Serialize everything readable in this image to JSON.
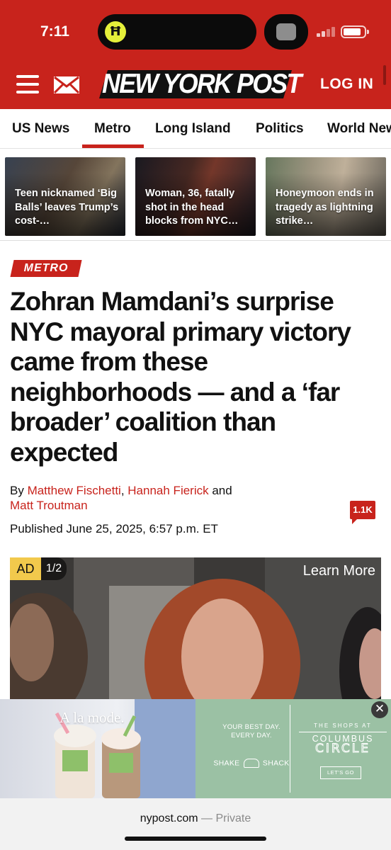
{
  "status_bar": {
    "time": "7:11",
    "island_app_glyph": "Ħ"
  },
  "header": {
    "logo_text": "NEW YORK POST",
    "login_label": "LOG IN",
    "background": "#c8231c"
  },
  "nav": {
    "items": [
      {
        "label": "US News",
        "active": false
      },
      {
        "label": "Metro",
        "active": true
      },
      {
        "label": "Long Island",
        "active": false
      },
      {
        "label": "Politics",
        "active": false
      },
      {
        "label": "World News",
        "active": false
      }
    ]
  },
  "trending": [
    {
      "title": "Teen nicknamed ‘Big Balls’ leaves Trump’s cost-…"
    },
    {
      "title": "Woman, 36, fatally shot in the head blocks from NYC…"
    },
    {
      "title": "Honeymoon ends in tragedy as lightning strike…"
    }
  ],
  "article": {
    "kicker": "METRO",
    "headline": "Zohran Mamdani’s surprise NYC mayoral primary victory came from these neighborhoods — and a ‘far broader’ coalition than expected",
    "byline_prefix": "By ",
    "authors": [
      "Matthew Fischetti",
      "Hannah Fierick",
      "Matt Troutman"
    ],
    "byline_sep": ", ",
    "byline_and": " and ",
    "comment_count": "1.1K",
    "published": "Published June 25, 2025, 6:57 p.m. ET"
  },
  "video_ad": {
    "badge": "AD",
    "counter": "1/2",
    "learn_more": "Learn More"
  },
  "banner_ad": {
    "headline": "A la mode.",
    "tagline_line1": "YOUR BEST DAY.",
    "tagline_line2": "EVERY DAY.",
    "brand_left": "SHAKE",
    "brand_right": "SHACK",
    "shops_at": "THE SHOPS AT",
    "columbus": "COLUMBUS",
    "circle": "CIRCLE",
    "cta": "LET'S GO",
    "close_glyph": "✕"
  },
  "url_bar": {
    "domain": "nypost.com",
    "separator": " — ",
    "mode": "Private"
  }
}
